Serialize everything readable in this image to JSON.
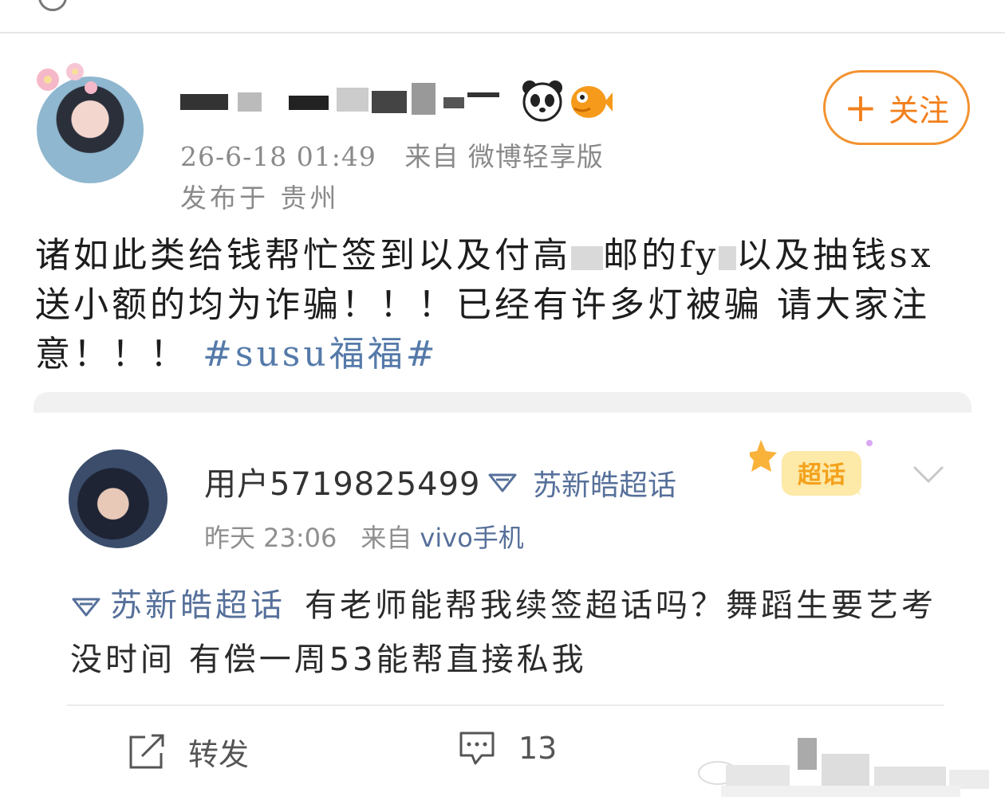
{
  "post": {
    "timestamp": "26-6-18 01:49",
    "source": "来自 微博轻享版",
    "location": "发布于 贵州",
    "follow_label": "关注",
    "text_part1": "诸如此类给钱帮忙签到以及付高",
    "text_part2": "邮的fy",
    "text_part3": "以及抽钱sx送小额的均为诈骗！！！已经有许多灯被骗",
    "text_part4": "请大家注意！！！",
    "hashtag": "#susu福福#"
  },
  "quoted": {
    "username": "用户5719825499",
    "supertopic": "苏新皓超话",
    "badge_label": "超话",
    "time": "昨天 23:06",
    "source_prefix": "来自",
    "source": "vivo手机",
    "topic": "苏新皓超话",
    "text": "有老师能帮我续签超话吗？舞蹈生要艺考没时间 有偿一周53能帮直接私我"
  },
  "actions": {
    "share_label": "转发",
    "comment_count": "13"
  },
  "colors": {
    "accent_orange": "#f27f1b",
    "link_blue": "#557aa9",
    "meta_gray": "#8a8a8a"
  }
}
